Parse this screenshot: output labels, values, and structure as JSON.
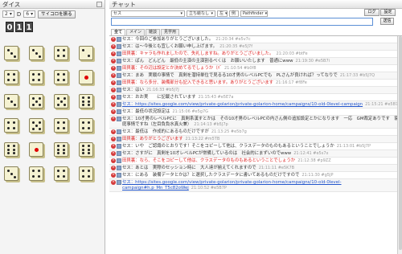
{
  "dice": {
    "title": "ダイス",
    "count": "2",
    "d": "D",
    "sides": "6",
    "roll_button": "サイコロを振る",
    "counter": [
      "0",
      "1",
      "1"
    ],
    "faces": [
      3,
      3,
      4,
      2,
      4,
      4,
      4,
      1,
      3,
      5,
      5,
      6,
      4,
      5,
      4,
      4,
      6,
      1,
      6,
      6,
      3,
      4,
      4,
      4
    ]
  },
  "chat": {
    "title": "チャット",
    "name": "セス",
    "stance": "立ち絵なし",
    "side": "左",
    "style": "例",
    "game": "Pathfinder",
    "buttons": {
      "log": "ログ",
      "setting": "設定",
      "send": "送信"
    },
    "tabs": [
      "全て",
      "メイン",
      "雑談",
      "見学用"
    ],
    "messages": [
      {
        "text": "セス：今回のご参加ありがとうございました。",
        "time": "21:20:34 #e5v7c"
      },
      {
        "text": "セス：は～今後とも宜しくお願い申し上げます。",
        "time": "21:20:35 #e5J7f"
      },
      {
        "text": "田貝裏：キャラも作れましたので、失礼しますね。ありがとうございました。",
        "time": "21:20:03 #btFe",
        "red": true
      },
      {
        "text": "セス：ぱん　どんどん　最低の主演の主演割るべくは　お願いいたします　普通にwww",
        "time": "21:19:30 #e5B7i"
      },
      {
        "text": "田貝裏：その辺は設定とか決めてるでしょうか（ﾊﾞ",
        "time": "21:10:54 #b0f8",
        "red": true
      },
      {
        "text": "セス：まあ　実戦の事情で　真剣を潜持単位で見るる10才男のレベルPCでも　PLさんが良ければ？ってなりで",
        "time": "21:17:33 #b5J7Q"
      },
      {
        "text": "田貝裏：なら多分、装備部分も記入できると思います。ありがとうございます",
        "time": "21:16:17 #f8Fe",
        "red": true
      },
      {
        "text": "セス：はい",
        "time": "21:16:33 #b5J7J"
      },
      {
        "text": "セス：おお実　　に記載されています",
        "time": "21:15:43 #e5E7a"
      },
      {
        "text": "セス：https://sites.google.com/view/private-golarion/private-golarion-home/campaigns/10-old-0level-campaign",
        "time": "21:15:21 #e5B7a",
        "link": true
      },
      {
        "text": "セス：最低の状況設定は",
        "time": "21:15:06 #e5g7G"
      },
      {
        "text": "セス：10才男のレベルPCに　真剣系漢すとかは　その10才男のレベルPCの内さん側の追加設定とかになります　一応　GM裁定ありです　家庭事情ですね（左目負負水真火兼）",
        "time": "21:14:13 #b5J7p"
      },
      {
        "text": "セス：最低は　作成的にあるものだけですが",
        "time": "21:13:25 #e5b7g"
      },
      {
        "text": "田貝裏：ありがとうございます",
        "time": "21:13:22 #m5TB",
        "red": true
      },
      {
        "text": "セス：いや　ご認識のとおりです！そこをコピーして他は、クラスデータのものもあるということでしょうか",
        "time": "21:13:01 #b5J7P"
      },
      {
        "text": "セス：さすがに　真剣を10才レベルPCが常備しているのは　社会的にまずいのでwww",
        "time": "21:12:41 #e5s7x"
      },
      {
        "text": "田貝裏：なら、そこをコピーして他は、クラスデータのものもあるということでしょうか",
        "time": "21:12:38 #p9ZZ",
        "red": true
      },
      {
        "text": "セス：あとは　実際のセッション時に　大人達が揃えてくれますので",
        "time": "21:11:11 #e5K7B"
      },
      {
        "text": "セス：にある　装備データとかは？と選択したクラスデータに書いてあるものだけですので",
        "time": "21:11:30 #g5JP"
      },
      {
        "text": "セス：https://sites.google.com/view/private-golarion/private-golarion-home/campaigns/10-old-0level-campaign#h.p_Mn_T5c82oWej",
        "time": "21:10:52 #e5B7P",
        "link": true
      }
    ]
  }
}
